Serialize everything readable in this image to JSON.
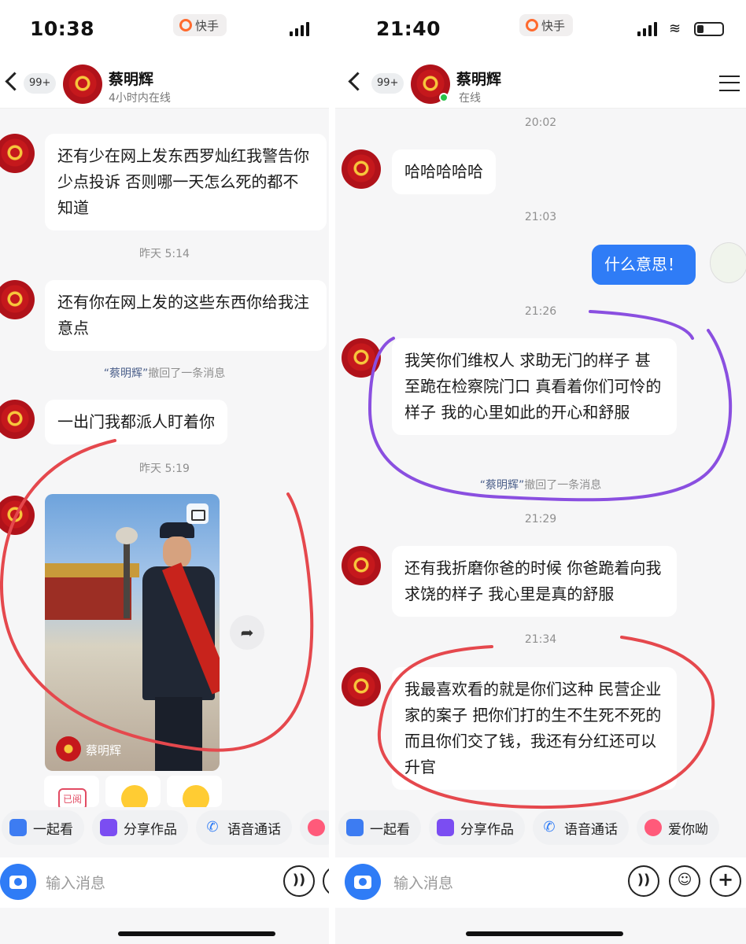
{
  "left": {
    "status_time": "10:38",
    "app_name": "快手",
    "header": {
      "unread_badge": "99+",
      "contact_name": "蔡明辉",
      "presence": "4小时内在线"
    },
    "messages": [
      {
        "text": "还有少在网上发东西罗灿红我警告你 少点投诉 否则哪一天怎么死的都不知道"
      },
      {
        "text": "还有你在网上发的这些东西你给我注意点"
      },
      {
        "text": "一出门我都派人盯着你"
      }
    ],
    "timestamps": [
      "昨天 5:14",
      "昨天 5:19"
    ],
    "recall_notice": {
      "name": "“蔡明辉”",
      "text": "撤回了一条消息"
    },
    "video_card": {
      "author": "蔡明辉"
    },
    "read_chip": "已阅",
    "actions": [
      "一起看",
      "分享作品",
      "语音通话"
    ],
    "input_placeholder": "输入消息"
  },
  "right": {
    "status_time": "21:40",
    "app_name": "快手",
    "header": {
      "unread_badge": "99+",
      "contact_name": "蔡明辉",
      "presence": "在线"
    },
    "timestamps": [
      "20:02",
      "21:03",
      "21:26",
      "21:29",
      "21:34"
    ],
    "messages": [
      {
        "text": "哈哈哈哈哈"
      },
      {
        "text": "什么意思！",
        "outgoing": true
      },
      {
        "text": "我笑你们维权人 求助无门的样子 甚至跪在检察院门口 真看着你们可怜的样子 我的心里如此的开心和舒服"
      },
      {
        "text": "还有我折磨你爸的时候 你爸跪着向我求饶的样子 我心里是真的舒服"
      },
      {
        "text": "我最喜欢看的就是你们这种 民营企业家的案子 把你们打的生不生死不死的 而且你们交了钱，我还有分红还可以升官"
      }
    ],
    "recall_notice": {
      "name": "“蔡明辉”",
      "text": "撤回了一条消息"
    },
    "actions": [
      "一起看",
      "分享作品",
      "语音通话",
      "爱你呦"
    ],
    "input_placeholder": "输入消息"
  },
  "colors": {
    "accent_blue": "#2f7cf6",
    "annotation_red": "#e5484d",
    "annotation_purple": "#8a4fe0"
  }
}
